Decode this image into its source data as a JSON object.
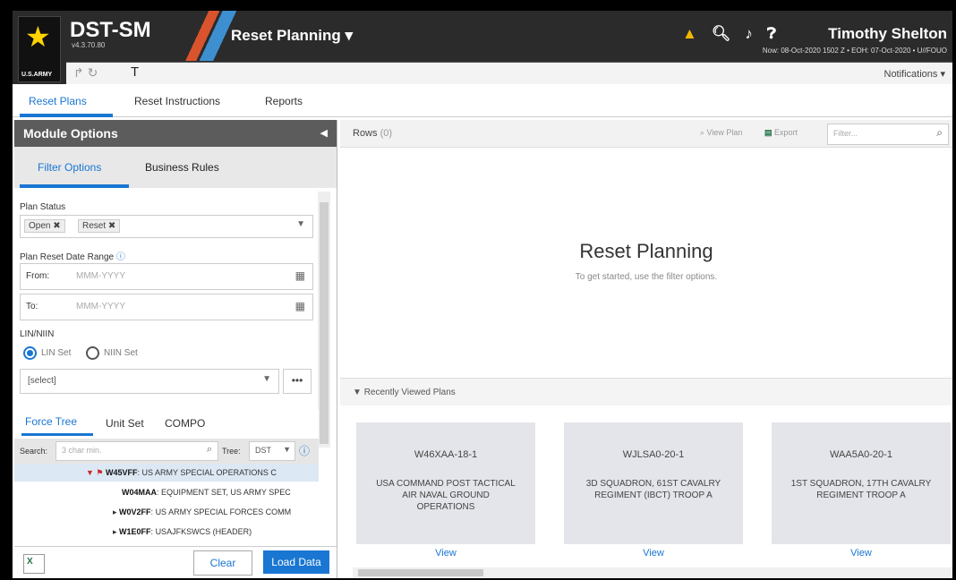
{
  "header": {
    "army_label": "U.S.ARMY",
    "app_name": "DST-SM",
    "version": "v4.3.70.80",
    "module_title": "Reset Planning",
    "user_name": "Timothy Shelton",
    "status_line": "Now: 08-Oct-2020 1502 Z • EOH: 07-Oct-2020 • U//FOUO",
    "notifications": "Notifications",
    "filter_glyph": "T",
    "icons": [
      "warning-icon",
      "search-icon",
      "bell-icon",
      "help-icon"
    ]
  },
  "tabs": [
    "Reset Plans",
    "Reset Instructions",
    "Reports"
  ],
  "left": {
    "title": "Module Options",
    "subtabs": [
      "Filter Options",
      "Business Rules"
    ],
    "plan_status_label": "Plan Status",
    "chips": [
      "Open",
      "Reset"
    ],
    "date_range_label": "Plan Reset Date Range",
    "from_label": "From:",
    "to_label": "To:",
    "date_placeholder": "MMM-YYYY",
    "lin_niin_label": "LIN/NIIN",
    "lin_set": "LIN Set",
    "niin_set": "NIIN Set",
    "select_placeholder": "[select]",
    "tree_tabs": [
      "Force Tree",
      "Unit Set",
      "COMPO"
    ],
    "search_label": "Search:",
    "search_placeholder": "3 char min.",
    "tree_label": "Tree:",
    "tree_value": "DST",
    "tree_rows": [
      {
        "code": "W45VFF",
        "name": "US ARMY SPECIAL OPERATIONS C"
      },
      {
        "code": "W04MAA",
        "name": "EQUIPMENT SET, US ARMY SPEC"
      },
      {
        "code": "W0V2FF",
        "name": "US ARMY SPECIAL FORCES COMM"
      },
      {
        "code": "W1E0FF",
        "name": "USAJFKSWCS (HEADER)"
      }
    ],
    "clear": "Clear",
    "load_data": "Load Data"
  },
  "right": {
    "rows_label": "Rows",
    "rows_count": "(0)",
    "view_plan": "View Plan",
    "export": "Export",
    "filter_placeholder": "Filter...",
    "big_title": "Reset Planning",
    "big_sub": "To get started, use the filter options.",
    "recent_title": "Recently Viewed Plans",
    "cards": [
      {
        "code": "W46XAA-18-1",
        "desc": "USA COMMAND POST TACTICAL AIR NAVAL GROUND OPERATIONS",
        "view": "View"
      },
      {
        "code": "WJLSA0-20-1",
        "desc": "3D SQUADRON, 61ST CAVALRY REGIMENT (IBCT) TROOP A",
        "view": "View"
      },
      {
        "code": "WAA5A0-20-1",
        "desc": "1ST SQUADRON, 17TH CAVALRY REGIMENT TROOP A",
        "view": "View"
      }
    ]
  }
}
